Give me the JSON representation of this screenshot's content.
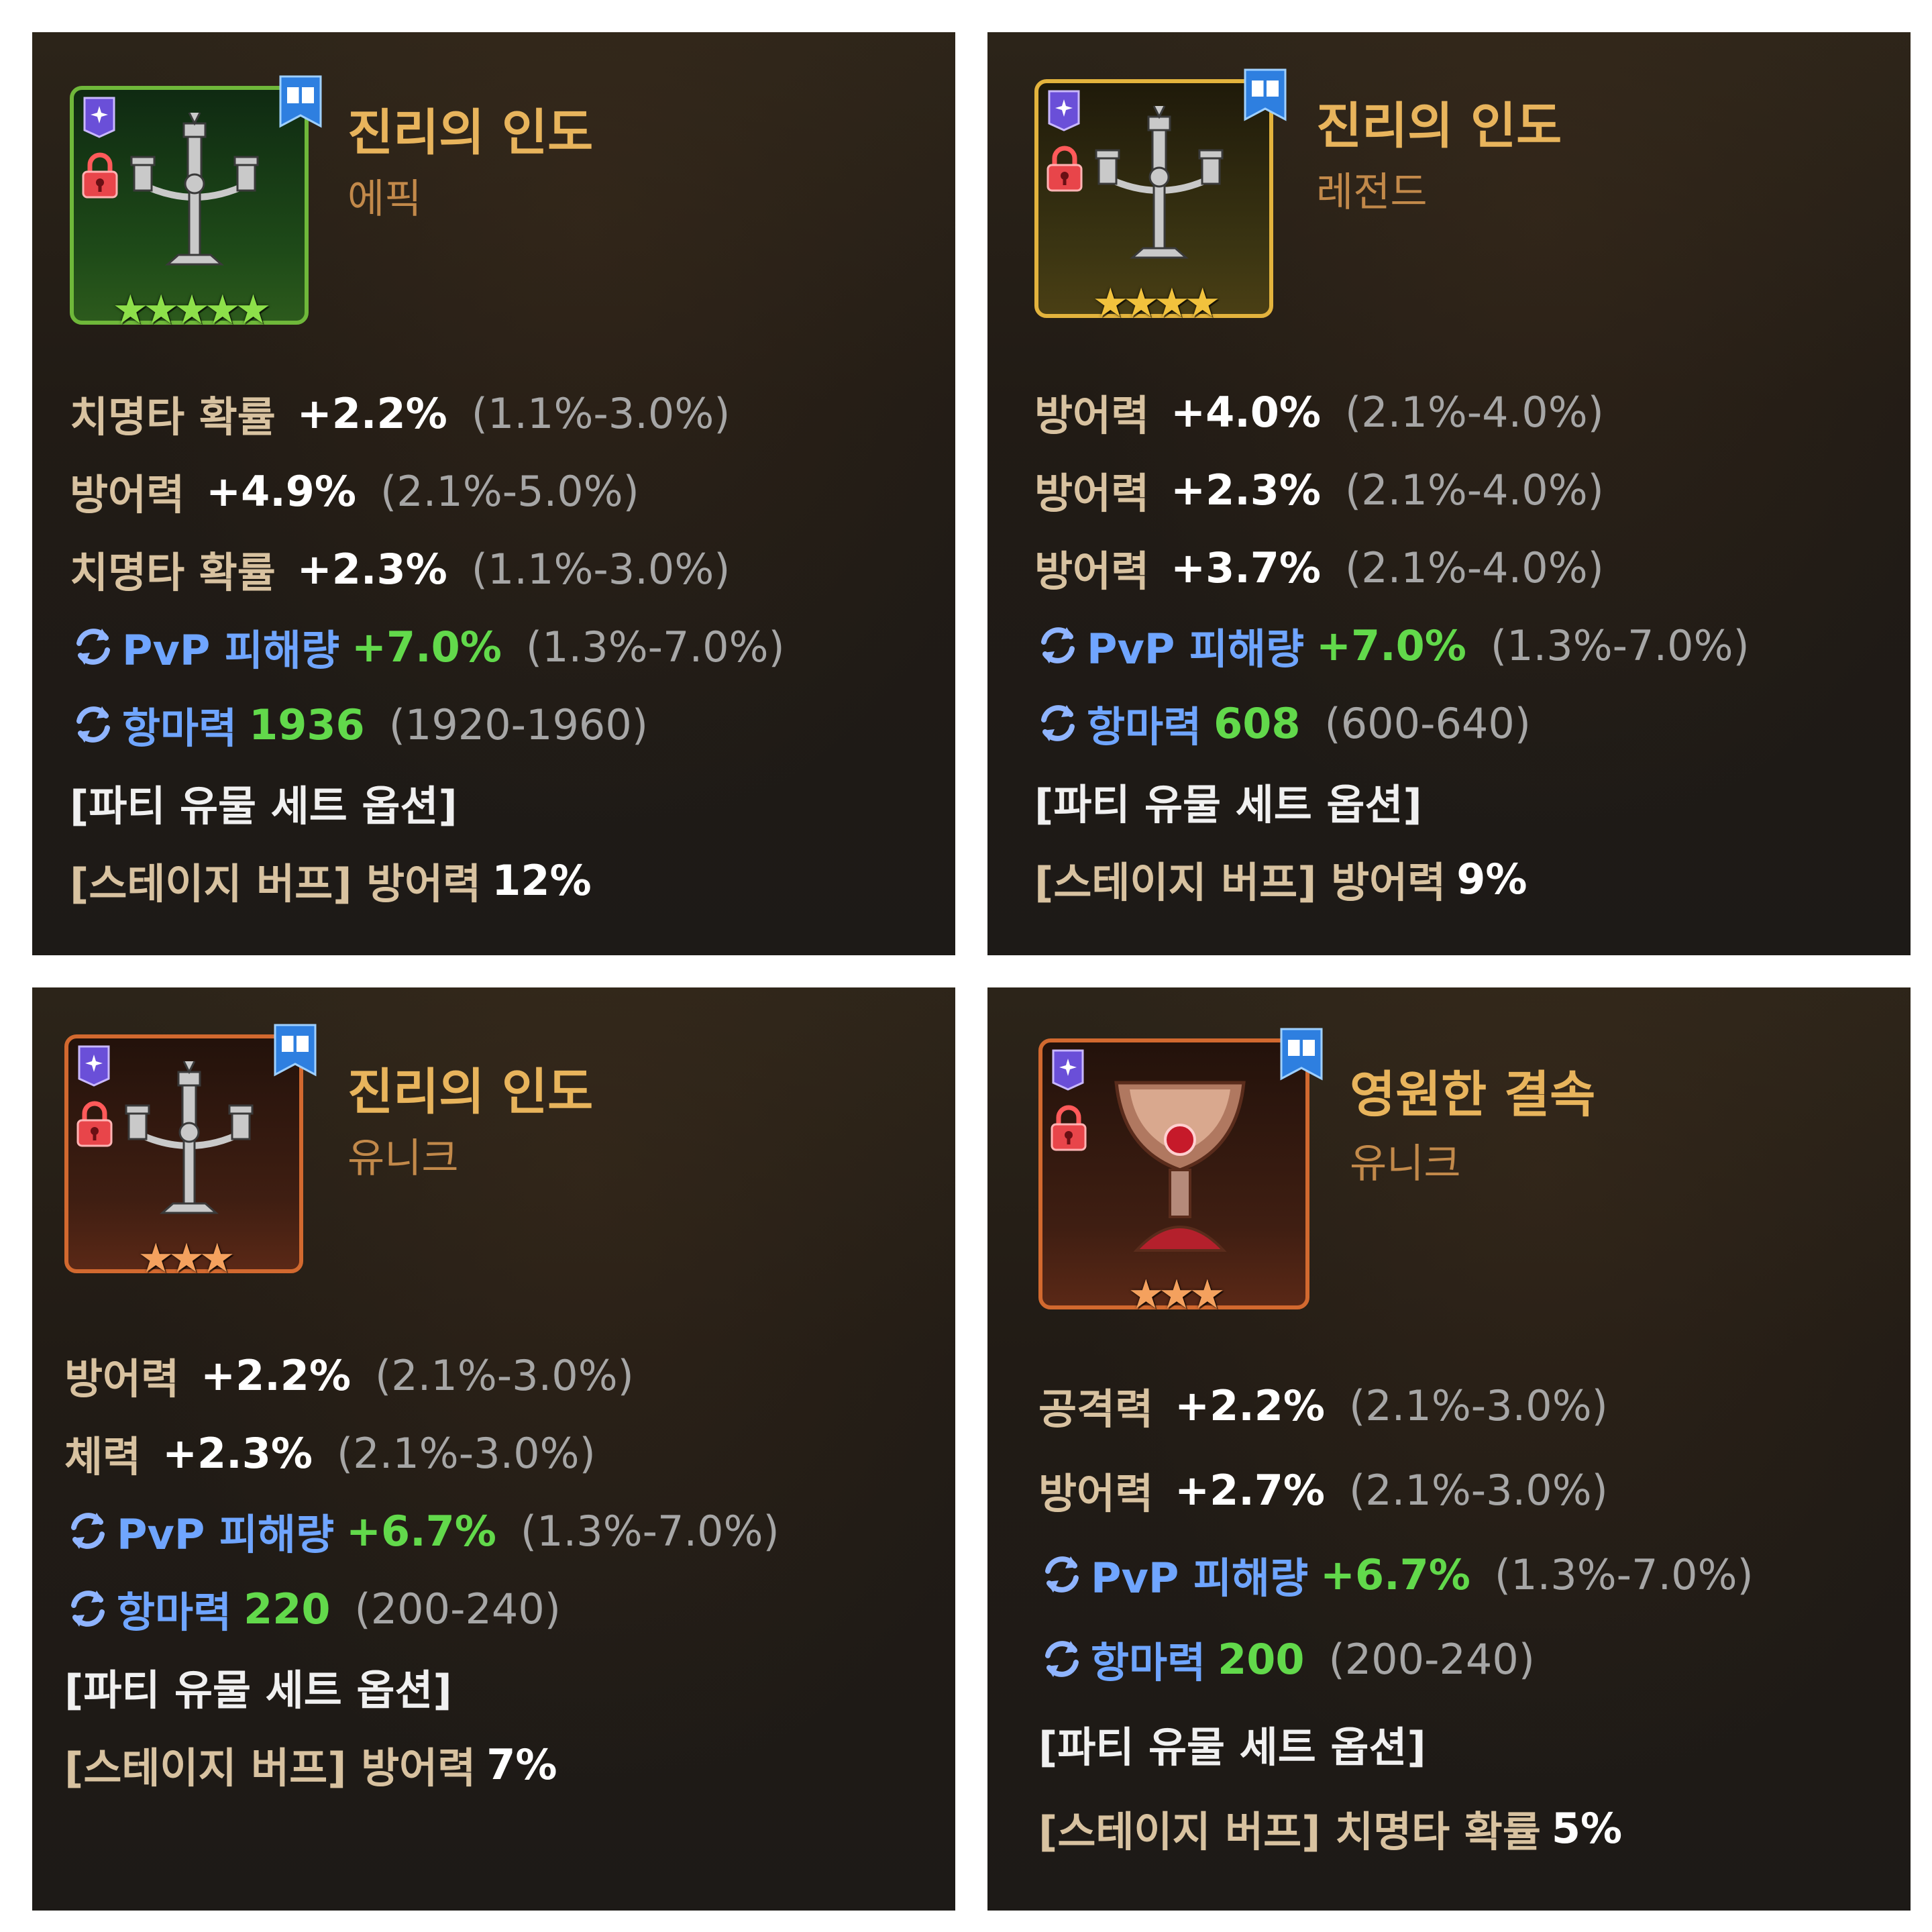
{
  "cards": [
    {
      "title": "진리의 인도",
      "grade": "에픽",
      "stars": "★★★★★",
      "stats": [
        {
          "label": "치명타 확률",
          "value": "+2.2%",
          "range": "(1.1%-3.0%)"
        },
        {
          "label": "방어력",
          "value": "+4.9%",
          "range": "(2.1%-5.0%)"
        },
        {
          "label": "치명타 확률",
          "value": "+2.3%",
          "range": "(1.1%-3.0%)"
        }
      ],
      "reroll": [
        {
          "label": "PvP 피해량",
          "value": "+7.0%",
          "range": "(1.3%-7.0%)"
        },
        {
          "label": "항마력",
          "value": "1936",
          "range": "(1920-1960)"
        }
      ],
      "set_title": "[파티 유물 세트 옵션]",
      "buff_label": "[스테이지 버프] 방어력",
      "buff_value": "12%"
    },
    {
      "title": "진리의 인도",
      "grade": "레전드",
      "stars": "★★★★",
      "stats": [
        {
          "label": "방어력",
          "value": "+4.0%",
          "range": "(2.1%-4.0%)"
        },
        {
          "label": "방어력",
          "value": "+2.3%",
          "range": "(2.1%-4.0%)"
        },
        {
          "label": "방어력",
          "value": "+3.7%",
          "range": "(2.1%-4.0%)"
        }
      ],
      "reroll": [
        {
          "label": "PvP 피해량",
          "value": "+7.0%",
          "range": "(1.3%-7.0%)"
        },
        {
          "label": "항마력",
          "value": "608",
          "range": "(600-640)"
        }
      ],
      "set_title": "[파티 유물 세트 옵션]",
      "buff_label": "[스테이지 버프] 방어력",
      "buff_value": "9%"
    },
    {
      "title": "진리의 인도",
      "grade": "유니크",
      "stars": "★★★",
      "stats": [
        {
          "label": "방어력",
          "value": "+2.2%",
          "range": "(2.1%-3.0%)"
        },
        {
          "label": "체력",
          "value": "+2.3%",
          "range": "(2.1%-3.0%)"
        }
      ],
      "reroll": [
        {
          "label": "PvP 피해량",
          "value": "+6.7%",
          "range": "(1.3%-7.0%)"
        },
        {
          "label": "항마력",
          "value": "220",
          "range": "(200-240)"
        }
      ],
      "set_title": "[파티 유물 세트 옵션]",
      "buff_label": "[스테이지 버프] 방어력",
      "buff_value": "7%"
    },
    {
      "title": "영원한 결속",
      "grade": "유니크",
      "stars": "★★★",
      "stats": [
        {
          "label": "공격력",
          "value": "+2.2%",
          "range": "(2.1%-3.0%)"
        },
        {
          "label": "방어력",
          "value": "+2.7%",
          "range": "(2.1%-3.0%)"
        }
      ],
      "reroll": [
        {
          "label": "PvP 피해량",
          "value": "+6.7%",
          "range": "(1.3%-7.0%)"
        },
        {
          "label": "항마력",
          "value": "200",
          "range": "(200-240)"
        }
      ],
      "set_title": "[파티 유물 세트 옵션]",
      "buff_label": "[스테이지 버프] 치명타 확률",
      "buff_value": "5%"
    }
  ]
}
